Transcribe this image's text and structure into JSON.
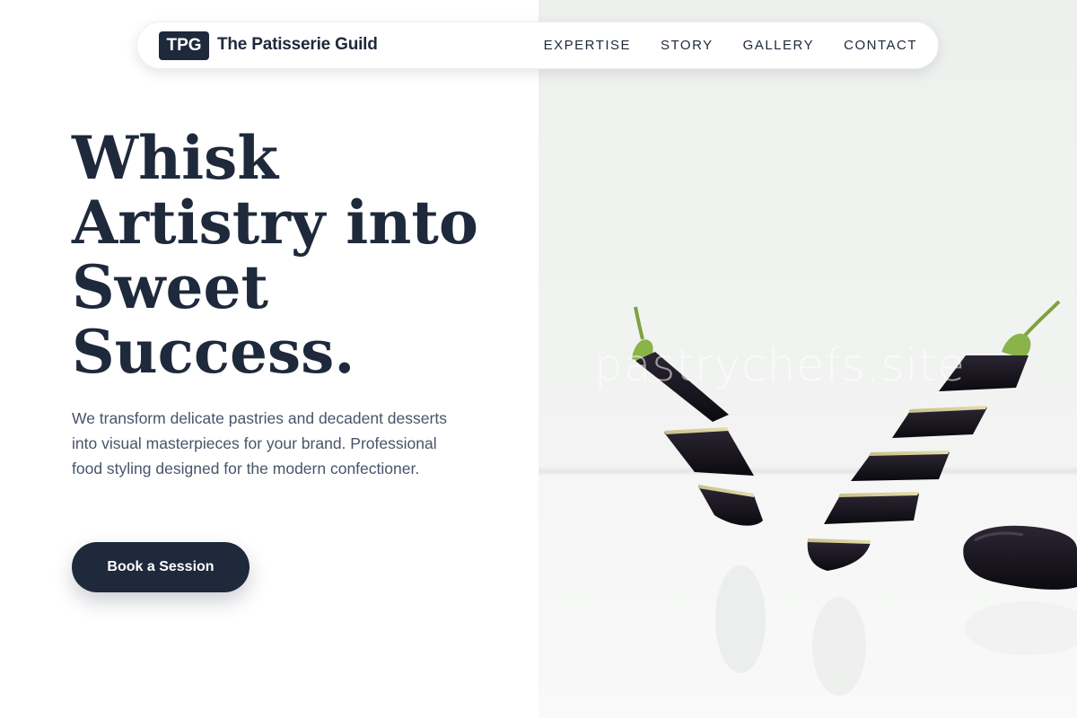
{
  "brand": {
    "badge": "TPG",
    "name": "The Patisserie Guild"
  },
  "nav": {
    "links": [
      "EXPERTISE",
      "STORY",
      "GALLERY",
      "CONTACT"
    ]
  },
  "hero": {
    "headline": [
      "Whisk",
      "Artistry into",
      "Sweet",
      "Success."
    ],
    "lead": "We transform delicate pastries and decadent desserts into visual masterpieces for your brand. Professional food styling designed for the modern confectioner.",
    "cta": "Book a Session"
  },
  "image": {
    "watermark": "pastrychefs.site",
    "subject": "sliced eggplants floating"
  },
  "colors": {
    "primary": "#1e293b",
    "text_muted": "#475569",
    "photo_bg": "#f1f3f1"
  }
}
